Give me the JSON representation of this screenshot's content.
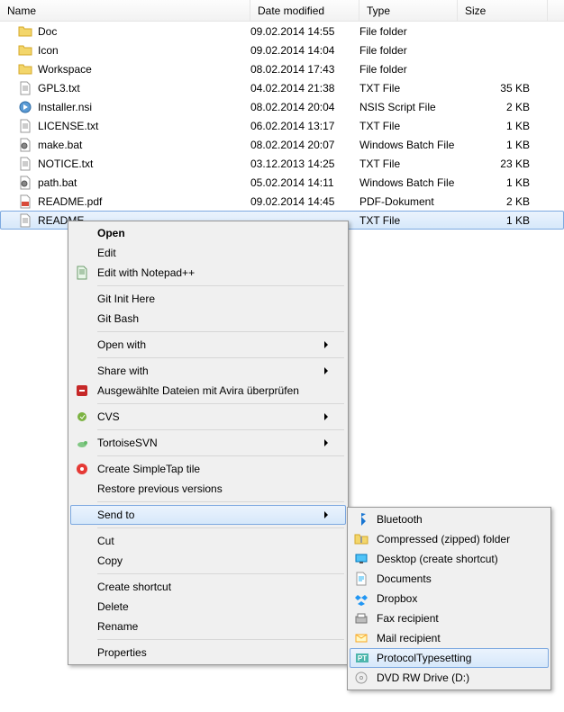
{
  "columns": {
    "name": "Name",
    "date": "Date modified",
    "type": "Type",
    "size": "Size"
  },
  "files": [
    {
      "icon": "folder",
      "name": "Doc",
      "date": "09.02.2014 14:55",
      "type": "File folder",
      "size": ""
    },
    {
      "icon": "folder",
      "name": "Icon",
      "date": "09.02.2014 14:04",
      "type": "File folder",
      "size": ""
    },
    {
      "icon": "folder",
      "name": "Workspace",
      "date": "08.02.2014 17:43",
      "type": "File folder",
      "size": ""
    },
    {
      "icon": "txt",
      "name": "GPL3.txt",
      "date": "04.02.2014 21:38",
      "type": "TXT File",
      "size": "35 KB"
    },
    {
      "icon": "nsi",
      "name": "Installer.nsi",
      "date": "08.02.2014 20:04",
      "type": "NSIS Script File",
      "size": "2 KB"
    },
    {
      "icon": "txt",
      "name": "LICENSE.txt",
      "date": "06.02.2014 13:17",
      "type": "TXT File",
      "size": "1 KB"
    },
    {
      "icon": "bat",
      "name": "make.bat",
      "date": "08.02.2014 20:07",
      "type": "Windows Batch File",
      "size": "1 KB"
    },
    {
      "icon": "txt",
      "name": "NOTICE.txt",
      "date": "03.12.2013 14:25",
      "type": "TXT File",
      "size": "23 KB"
    },
    {
      "icon": "bat",
      "name": "path.bat",
      "date": "05.02.2014 14:11",
      "type": "Windows Batch File",
      "size": "1 KB"
    },
    {
      "icon": "pdf",
      "name": "README.pdf",
      "date": "09.02.2014 14:45",
      "type": "PDF-Dokument",
      "size": "2 KB"
    },
    {
      "icon": "txt",
      "name": "README",
      "date": "",
      "type": "TXT File",
      "size": "1 KB",
      "selected": true
    }
  ],
  "context_menu": [
    {
      "label": "Open",
      "bold": true
    },
    {
      "label": "Edit"
    },
    {
      "label": "Edit with Notepad++",
      "icon": "notepad"
    },
    {
      "sep": true
    },
    {
      "label": "Git Init Here"
    },
    {
      "label": "Git Bash"
    },
    {
      "sep": true
    },
    {
      "label": "Open with",
      "arrow": true
    },
    {
      "sep": true
    },
    {
      "label": "Share with",
      "arrow": true
    },
    {
      "label": "Ausgewählte Dateien mit Avira überprüfen",
      "icon": "avira"
    },
    {
      "sep": true
    },
    {
      "label": "CVS",
      "arrow": true,
      "icon": "cvs"
    },
    {
      "sep": true
    },
    {
      "label": "TortoiseSVN",
      "arrow": true,
      "icon": "tortoise"
    },
    {
      "sep": true
    },
    {
      "label": "Create SimpleTap tile",
      "icon": "simpletap"
    },
    {
      "label": "Restore previous versions"
    },
    {
      "sep": true
    },
    {
      "label": "Send to",
      "arrow": true,
      "highlight": true
    },
    {
      "sep": true
    },
    {
      "label": "Cut"
    },
    {
      "label": "Copy"
    },
    {
      "sep": true
    },
    {
      "label": "Create shortcut"
    },
    {
      "label": "Delete"
    },
    {
      "label": "Rename"
    },
    {
      "sep": true
    },
    {
      "label": "Properties"
    }
  ],
  "submenu": [
    {
      "label": "Bluetooth",
      "icon": "bluetooth"
    },
    {
      "label": "Compressed (zipped) folder",
      "icon": "zip"
    },
    {
      "label": "Desktop (create shortcut)",
      "icon": "desktop"
    },
    {
      "label": "Documents",
      "icon": "documents"
    },
    {
      "label": "Dropbox",
      "icon": "dropbox"
    },
    {
      "label": "Fax recipient",
      "icon": "fax"
    },
    {
      "label": "Mail recipient",
      "icon": "mail"
    },
    {
      "label": "ProtocolTypesetting",
      "icon": "pt",
      "highlight": true
    },
    {
      "label": "DVD RW Drive (D:)",
      "icon": "dvd"
    }
  ]
}
